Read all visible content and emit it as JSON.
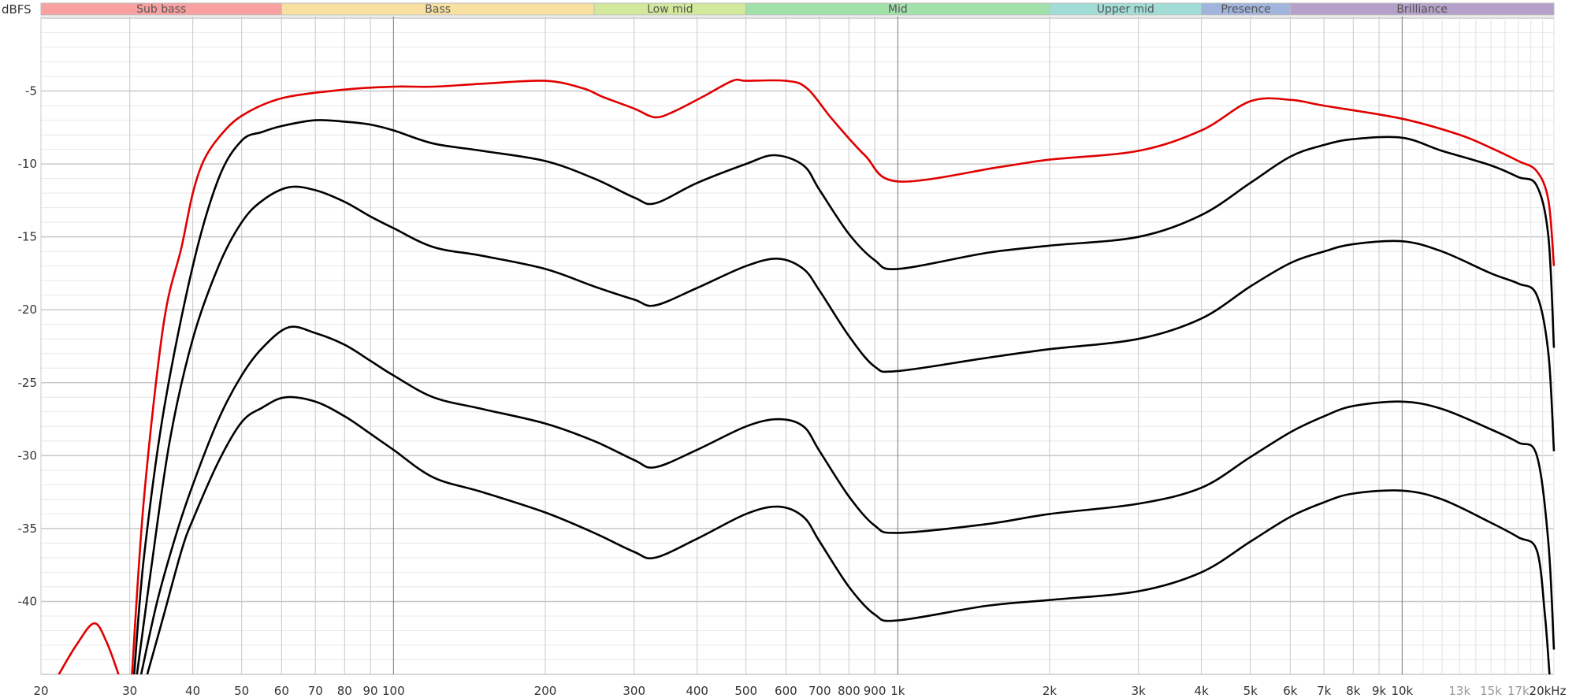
{
  "chart_data": {
    "type": "line",
    "title": "",
    "ylabel": "dBFS",
    "xlabel": "",
    "xscale": "log",
    "xlim": [
      20,
      20000
    ],
    "ylim": [
      -45,
      0
    ],
    "grid": true,
    "y_ticks": [
      -5,
      -10,
      -15,
      -20,
      -25,
      -30,
      -35,
      -40
    ],
    "y_tick_labels": [
      "-5",
      "-10",
      "-15",
      "-20",
      "-25",
      "-30",
      "-35",
      "-40"
    ],
    "x_ticks": [
      20,
      30,
      40,
      50,
      60,
      70,
      80,
      90,
      100,
      200,
      300,
      400,
      500,
      600,
      700,
      800,
      900,
      1000,
      2000,
      3000,
      4000,
      5000,
      6000,
      7000,
      8000,
      9000,
      10000,
      13000,
      15000,
      17000,
      20000
    ],
    "x_tick_labels": [
      "20",
      "30",
      "40",
      "50",
      "60",
      "70",
      "80",
      "90",
      "100",
      "200",
      "300",
      "400",
      "500",
      "600",
      "700",
      "800",
      "900",
      "1k",
      "2k",
      "3k",
      "4k",
      "5k",
      "6k",
      "7k",
      "8k",
      "9k",
      "10k",
      "13k",
      "15k",
      "17k",
      "20kHz"
    ],
    "minor_x_labels": [
      "13k",
      "15k",
      "17k"
    ],
    "bands": [
      {
        "label": "Sub bass",
        "from": 20,
        "to": 60,
        "color": "#f9a0a0"
      },
      {
        "label": "Bass",
        "from": 60,
        "to": 250,
        "color": "#f7e0a0"
      },
      {
        "label": "Low mid",
        "from": 250,
        "to": 500,
        "color": "#d2e99c"
      },
      {
        "label": "Mid",
        "from": 500,
        "to": 2000,
        "color": "#a1e2ab"
      },
      {
        "label": "Upper mid",
        "from": 2000,
        "to": 4000,
        "color": "#a1ddd6"
      },
      {
        "label": "Presence",
        "from": 4000,
        "to": 6000,
        "color": "#a1b4dc"
      },
      {
        "label": "Brilliance",
        "from": 6000,
        "to": 20000,
        "color": "#b4a0c8"
      }
    ],
    "series": [
      {
        "name": "red",
        "color": "#e00000",
        "segments": [
          {
            "x": [
              21.7,
              23.5,
              25.5,
              27,
              28.5
            ],
            "y": [
              -45,
              -43,
              -41.5,
              -42.8,
              -45
            ]
          },
          {
            "x": [
              30.3,
              32,
              35,
              38,
              40,
              42,
              45,
              50,
              60,
              80,
              100,
              120,
              150,
              200,
              237,
              260,
              300,
              330,
              360,
              410,
              470,
              500,
              600,
              660,
              740,
              860,
              1000,
              1600,
              2000,
              3000,
              4000,
              5000,
              6000,
              7000,
              10000,
              13000,
              15000,
              17000,
              18500,
              19500,
              20000
            ],
            "y": [
              -45,
              -33,
              -21,
              -15.7,
              -12,
              -9.8,
              -8.2,
              -6.7,
              -5.5,
              -4.9,
              -4.7,
              -4.7,
              -4.5,
              -4.3,
              -4.8,
              -5.4,
              -6.2,
              -6.8,
              -6.4,
              -5.4,
              -4.3,
              -4.3,
              -4.3,
              -4.8,
              -6.9,
              -9.4,
              -11.2,
              -10.2,
              -9.7,
              -9.1,
              -7.7,
              -5.7,
              -5.6,
              -6.0,
              -6.9,
              -8.0,
              -8.9,
              -9.8,
              -10.5,
              -12.5,
              -17
            ]
          }
        ]
      },
      {
        "name": "black-1",
        "color": "#000000",
        "segments": [
          {
            "x": [
              30.6,
              32,
              35,
              40,
              45,
              50,
              55,
              60,
              70,
              80,
              90,
              100,
              120,
              150,
              200,
              250,
              300,
              330,
              400,
              500,
              570,
              650,
              700,
              800,
              900,
              1000,
              1500,
              2000,
              3000,
              4000,
              5000,
              6000,
              7000,
              8000,
              10000,
              12000,
              15000,
              17000,
              18500,
              19500,
              20000
            ],
            "y": [
              -45,
              -37,
              -27,
              -17,
              -11,
              -8.4,
              -7.8,
              -7.4,
              -7.0,
              -7.1,
              -7.3,
              -7.7,
              -8.6,
              -9.1,
              -9.8,
              -11,
              -12.3,
              -12.7,
              -11.3,
              -10,
              -9.4,
              -10.1,
              -11.8,
              -14.8,
              -16.6,
              -17.2,
              -16.1,
              -15.6,
              -15,
              -13.5,
              -11.3,
              -9.5,
              -8.7,
              -8.3,
              -8.2,
              -9.1,
              -10.1,
              -10.9,
              -11.5,
              -15,
              -22.6
            ]
          }
        ]
      },
      {
        "name": "black-2",
        "color": "#000000",
        "segments": [
          {
            "x": [
              31,
              33,
              36,
              40,
              45,
              50,
              55,
              62,
              70,
              80,
              90,
              100,
              120,
              150,
              200,
              250,
              300,
              330,
              400,
              500,
              580,
              650,
              700,
              800,
              900,
              1000,
              1500,
              2000,
              3000,
              4000,
              5000,
              6000,
              7000,
              8000,
              10000,
              12000,
              15000,
              17000,
              18500,
              19500,
              20000
            ],
            "y": [
              -45,
              -38,
              -29,
              -22,
              -17,
              -14,
              -12.5,
              -11.6,
              -11.8,
              -12.6,
              -13.6,
              -14.4,
              -15.7,
              -16.3,
              -17.2,
              -18.4,
              -19.3,
              -19.7,
              -18.5,
              -17,
              -16.5,
              -17.2,
              -18.7,
              -21.8,
              -23.9,
              -24.2,
              -23.3,
              -22.7,
              -22,
              -20.6,
              -18.4,
              -16.8,
              -16,
              -15.5,
              -15.3,
              -16,
              -17.5,
              -18.2,
              -19,
              -23,
              -29.7
            ]
          }
        ]
      },
      {
        "name": "black-3",
        "color": "#000000",
        "segments": [
          {
            "x": [
              31.6,
              34,
              37,
              40,
              45,
              50,
              55,
              62,
              70,
              80,
              90,
              100,
              120,
              150,
              200,
              250,
              300,
              330,
              400,
              500,
              580,
              650,
              700,
              800,
              900,
              1000,
              1500,
              2000,
              3000,
              4000,
              5000,
              6000,
              7000,
              8000,
              10000,
              12000,
              15000,
              17000,
              18500,
              19500,
              20000
            ],
            "y": [
              -45,
              -40,
              -35.5,
              -32,
              -27.5,
              -24.5,
              -22.6,
              -21.2,
              -21.6,
              -22.4,
              -23.5,
              -24.5,
              -26,
              -26.8,
              -27.8,
              -29,
              -30.3,
              -30.8,
              -29.6,
              -28,
              -27.5,
              -28,
              -29.7,
              -32.8,
              -34.8,
              -35.3,
              -34.7,
              -34,
              -33.3,
              -32.2,
              -30.1,
              -28.4,
              -27.3,
              -26.6,
              -26.3,
              -26.8,
              -28.2,
              -29.1,
              -30,
              -36,
              -43.3
            ]
          }
        ]
      },
      {
        "name": "black-4",
        "color": "#000000",
        "segments": [
          {
            "x": [
              32.5,
              35,
              38,
              40,
              45,
              50,
              55,
              61,
              70,
              80,
              90,
              100,
              120,
              150,
              200,
              250,
              300,
              330,
              400,
              500,
              580,
              650,
              700,
              800,
              900,
              1000,
              1500,
              2000,
              3000,
              4000,
              5000,
              6000,
              7000,
              8000,
              10000,
              12000,
              15000,
              17000,
              18500,
              19200,
              19600
            ],
            "y": [
              -45,
              -41,
              -36.5,
              -34.4,
              -30.4,
              -27.7,
              -26.7,
              -26,
              -26.3,
              -27.3,
              -28.5,
              -29.6,
              -31.5,
              -32.5,
              -33.9,
              -35.3,
              -36.6,
              -37,
              -35.7,
              -34,
              -33.5,
              -34.2,
              -35.9,
              -39,
              -40.9,
              -41.3,
              -40.3,
              -39.9,
              -39.3,
              -38,
              -35.9,
              -34.2,
              -33.2,
              -32.6,
              -32.4,
              -33,
              -34.6,
              -35.6,
              -36.5,
              -41,
              -45
            ]
          }
        ]
      }
    ]
  }
}
